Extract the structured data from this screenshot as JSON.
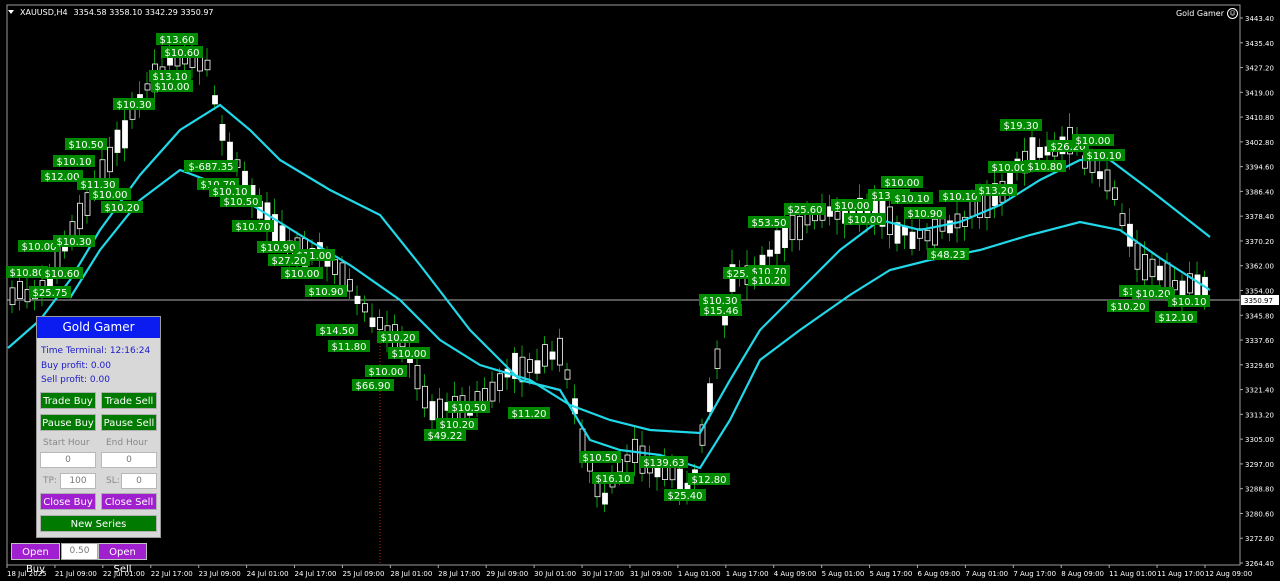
{
  "header": {
    "symbol": "XAUUSD,H4",
    "ohlc": "3354.58 3358.10 3342.29 3350.97",
    "expert": "Gold Gamer"
  },
  "price_axis": {
    "labels": [
      "3443.40",
      "3435.40",
      "3427.20",
      "3419.00",
      "3410.80",
      "3402.80",
      "3394.60",
      "3386.40",
      "3378.40",
      "3370.20",
      "3362.00",
      "3354.00",
      "3345.80",
      "3337.60",
      "3329.60",
      "3321.40",
      "3313.20",
      "3305.00",
      "3297.00",
      "3288.80",
      "3280.60",
      "3272.60",
      "3264.40"
    ],
    "current_price": "3350.97"
  },
  "time_axis": {
    "labels": [
      "18 Jul 2025",
      "21 Jul 09:00",
      "22 Jul 01:00",
      "22 Jul 17:00",
      "23 Jul 09:00",
      "24 Jul 01:00",
      "24 Jul 17:00",
      "25 Jul 09:00",
      "28 Jul 01:00",
      "28 Jul 17:00",
      "29 Jul 09:00",
      "30 Jul 01:00",
      "30 Jul 17:00",
      "31 Jul 09:00",
      "1 Aug 01:00",
      "1 Aug 17:00",
      "4 Aug 09:00",
      "5 Aug 01:00",
      "5 Aug 17:00",
      "6 Aug 09:00",
      "7 Aug 01:00",
      "7 Aug 17:00",
      "8 Aug 09:00",
      "11 Aug 01:00",
      "11 Aug 17:00",
      "12 Aug 09:00"
    ]
  },
  "chart_labels": [
    {
      "t": "$13.60"
    },
    {
      "t": "$10.60"
    },
    {
      "t": "$13.10"
    },
    {
      "t": "$10.00"
    },
    {
      "t": "$10.30"
    },
    {
      "t": "$10.50"
    },
    {
      "t": "$10.10"
    },
    {
      "t": "$12.00"
    },
    {
      "t": "$11.30"
    },
    {
      "t": "$10.00"
    },
    {
      "t": "$10.20"
    },
    {
      "t": "$10.00"
    },
    {
      "t": "$10.30"
    },
    {
      "t": "$10.80"
    },
    {
      "t": "$10.60"
    },
    {
      "t": "$25.75"
    },
    {
      "t": "$-687.35"
    },
    {
      "t": "$10.70"
    },
    {
      "t": "$10.10"
    },
    {
      "t": "$10.50"
    },
    {
      "t": "$10.70"
    },
    {
      "t": "$10.90"
    },
    {
      "t": "$11.00"
    },
    {
      "t": "$27.20"
    },
    {
      "t": "$10.00"
    },
    {
      "t": "$10.90"
    },
    {
      "t": "$14.50"
    },
    {
      "t": "$11.80"
    },
    {
      "t": "$10.20"
    },
    {
      "t": "$10.00"
    },
    {
      "t": "$10.00"
    },
    {
      "t": "$66.90"
    },
    {
      "t": "$10.50"
    },
    {
      "t": "$10.20"
    },
    {
      "t": "$49.22"
    },
    {
      "t": "$11.20"
    },
    {
      "t": "$10.50"
    },
    {
      "t": "$16.10"
    },
    {
      "t": "$139.63"
    },
    {
      "t": "$12.80"
    },
    {
      "t": "$25.40"
    },
    {
      "t": "$10.30"
    },
    {
      "t": "$15.46"
    },
    {
      "t": "$25.10"
    },
    {
      "t": "$10.70"
    },
    {
      "t": "$10.20"
    },
    {
      "t": "$53.50"
    },
    {
      "t": "$25.60"
    },
    {
      "t": "$10.00"
    },
    {
      "t": "$10.00"
    },
    {
      "t": "$10.00"
    },
    {
      "t": "$13.00"
    },
    {
      "t": "$10.10"
    },
    {
      "t": "$10.90"
    },
    {
      "t": "$48.23"
    },
    {
      "t": "$10.10"
    },
    {
      "t": "$13.20"
    },
    {
      "t": "$10.00"
    },
    {
      "t": "$10.80"
    },
    {
      "t": "$19.30"
    },
    {
      "t": "$26.20"
    },
    {
      "t": "$10.00"
    },
    {
      "t": "$10.10"
    },
    {
      "t": "$12.40"
    },
    {
      "t": "$10.20"
    },
    {
      "t": "$10.20"
    },
    {
      "t": "$10.10"
    },
    {
      "t": "$12.10"
    }
  ],
  "panel": {
    "title": "Gold Gamer",
    "time_terminal": "Time Terminal: 12:16:24",
    "buy_profit": "Buy profit: 0.00",
    "sell_profit": "Sell profit: 0.00",
    "trade_buy": "Trade Buy",
    "trade_sell": "Trade Sell",
    "pause_buy": "Pause Buy",
    "pause_sell": "Pause Sell",
    "start_hour_label": "Start Hour",
    "end_hour_label": "End Hour",
    "start_hour_value": "0",
    "end_hour_value": "0",
    "tp_label": "TP:",
    "tp_value": "100",
    "sl_label": "SL:",
    "sl_value": "0",
    "close_buy": "Close Buy",
    "close_sell": "Close Sell",
    "new_series": "New Series"
  },
  "bottom": {
    "open_buy": "Open Buy",
    "lot_value": "0.50",
    "open_sell": "Open Sell"
  },
  "colors": {
    "background": "#000000",
    "ma": "#20d8e8",
    "candle": "#ffffff",
    "candle_wick": "#0f9a0f",
    "label_bg": "#008a00",
    "panel_title": "#0a1cf0",
    "button_green": "#007a00",
    "button_purple": "#a020d0"
  }
}
